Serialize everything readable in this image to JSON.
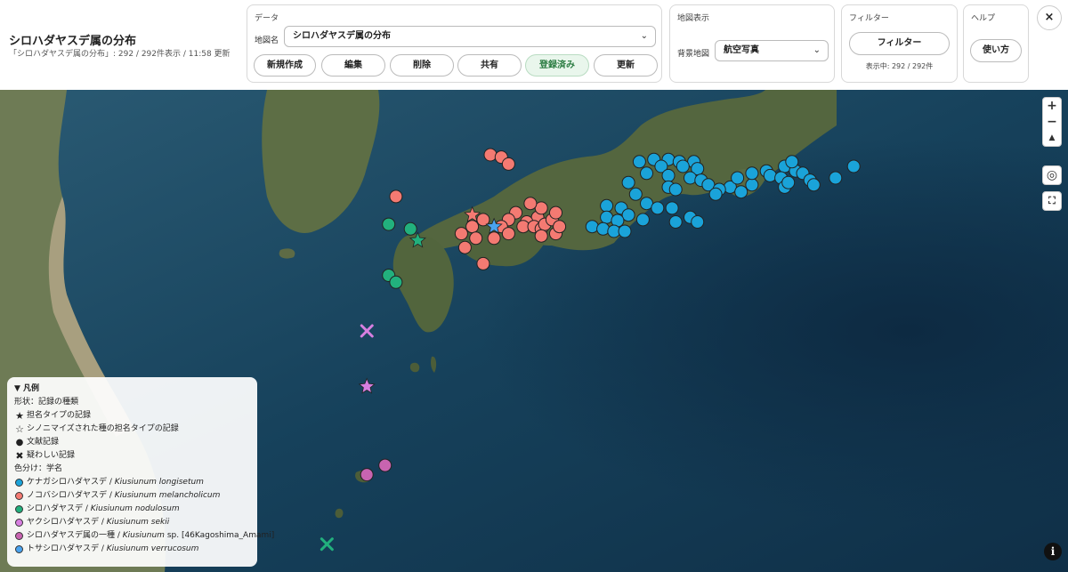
{
  "app": {
    "title": "シロハダヤスデ属の分布",
    "status": "「シロハダヤスデ属の分布」: 292 / 292件表示 / 11:58 更新"
  },
  "data_panel": {
    "label": "データ",
    "map_name_label": "地図名",
    "map_name_value": "シロハダヤスデ属の分布",
    "buttons": [
      "新規作成",
      "編集",
      "削除",
      "共有",
      "登録済み",
      "更新"
    ]
  },
  "map_display": {
    "label": "地図表示",
    "basemap_label": "背景地図",
    "basemap_value": "航空写真"
  },
  "filter_panel": {
    "label": "フィルター",
    "button": "フィルター",
    "status": "表示中: 292 / 292件"
  },
  "help_panel": {
    "label": "ヘルプ",
    "button": "使い方"
  },
  "icons": {
    "close": "×",
    "zoom_in": "+",
    "zoom_out": "−",
    "compass": "▲",
    "locate": "◎",
    "fullscreen": "⛶",
    "info": "i",
    "chevron": "⌄",
    "triangle": "▼"
  },
  "legend": {
    "title": "▼ 凡例",
    "shape_heading": "形状：記録の種類",
    "shapes": [
      {
        "symbol": "★",
        "label": "担名タイプの記録"
      },
      {
        "symbol": "☆",
        "label": "シノニマイズされた種の担名タイプの記録"
      },
      {
        "symbol": "●",
        "label": "文献記録"
      },
      {
        "symbol": "✖",
        "label": "疑わしい記録"
      }
    ],
    "color_heading": "色分け：学名",
    "species": [
      {
        "jp": "ケナガシロハダヤスデ",
        "sci": "Kiusiunum longisetum",
        "suffix": "",
        "color": "#1aa3d9"
      },
      {
        "jp": "ノコバシロハダヤスデ",
        "sci": "Kiusiunum melancholicum",
        "suffix": "",
        "color": "#f47a72"
      },
      {
        "jp": "シロハダヤスデ",
        "sci": "Kiusiunum nodulosum",
        "suffix": "",
        "color": "#22b07d"
      },
      {
        "jp": "ヤクシロハダヤスデ",
        "sci": "Kiusiunum sekii",
        "suffix": "",
        "color": "#d77fe0"
      },
      {
        "jp": "シロハダヤスデ属の一種",
        "sci": "Kiusiunum",
        "suffix": " sp. [46Kagoshima_Amami]",
        "color": "#c864b0"
      },
      {
        "jp": "トサシロハダヤスデ",
        "sci": "Kiusiunum verrucosum",
        "suffix": "",
        "color": "#4aa3ef"
      }
    ]
  },
  "records": {
    "longisetum": [
      [
        136.1,
        35.25
      ],
      [
        136.3,
        35.3
      ],
      [
        136.5,
        35.3
      ],
      [
        136.65,
        35.25
      ],
      [
        136.85,
        35.25
      ],
      [
        136.4,
        35.15
      ],
      [
        136.7,
        35.15
      ],
      [
        136.9,
        35.1
      ],
      [
        136.2,
        35.0
      ],
      [
        136.5,
        34.95
      ],
      [
        136.8,
        34.9
      ],
      [
        136.95,
        34.85
      ],
      [
        135.95,
        34.8
      ],
      [
        136.05,
        34.55
      ],
      [
        136.5,
        34.7
      ],
      [
        136.6,
        34.65
      ],
      [
        137.05,
        34.75
      ],
      [
        137.35,
        34.7
      ],
      [
        137.2,
        34.65
      ],
      [
        137.15,
        34.55
      ],
      [
        137.5,
        34.6
      ],
      [
        137.65,
        34.75
      ],
      [
        137.45,
        34.9
      ],
      [
        137.65,
        35.0
      ],
      [
        137.85,
        35.05
      ],
      [
        137.9,
        34.95
      ],
      [
        138.1,
        35.15
      ],
      [
        138.05,
        34.9
      ],
      [
        138.25,
        35.05
      ],
      [
        138.35,
        35.0
      ],
      [
        138.1,
        34.7
      ],
      [
        138.15,
        34.8
      ],
      [
        138.45,
        34.85
      ],
      [
        138.5,
        34.75
      ],
      [
        138.8,
        34.9
      ],
      [
        139.05,
        35.15
      ],
      [
        138.2,
        35.25
      ],
      [
        135.65,
        34.3
      ],
      [
        135.85,
        34.25
      ],
      [
        135.95,
        34.1
      ],
      [
        135.65,
        34.05
      ],
      [
        135.8,
        33.98
      ],
      [
        135.45,
        33.85
      ],
      [
        135.6,
        33.8
      ],
      [
        135.75,
        33.75
      ],
      [
        135.9,
        33.75
      ],
      [
        136.2,
        34.35
      ],
      [
        136.35,
        34.25
      ],
      [
        136.55,
        34.25
      ],
      [
        136.8,
        34.05
      ],
      [
        136.9,
        33.95
      ],
      [
        136.6,
        33.95
      ],
      [
        136.15,
        34.0
      ]
    ],
    "melancholicum": [
      [
        134.05,
        35.4
      ],
      [
        134.2,
        35.35
      ],
      [
        134.3,
        35.2
      ],
      [
        132.75,
        34.5
      ],
      [
        134.7,
        34.05
      ],
      [
        134.55,
        33.95
      ],
      [
        134.4,
        34.15
      ],
      [
        134.3,
        34.0
      ],
      [
        134.5,
        33.85
      ],
      [
        134.65,
        33.85
      ],
      [
        134.75,
        33.8
      ],
      [
        134.8,
        33.9
      ],
      [
        134.9,
        34.0
      ],
      [
        134.95,
        34.15
      ],
      [
        134.75,
        34.25
      ],
      [
        134.6,
        34.35
      ],
      [
        134.95,
        33.7
      ],
      [
        134.75,
        33.65
      ],
      [
        135.0,
        33.85
      ],
      [
        134.2,
        33.85
      ],
      [
        133.95,
        34.0
      ],
      [
        133.8,
        33.85
      ],
      [
        133.65,
        33.7
      ],
      [
        133.85,
        33.6
      ],
      [
        133.7,
        33.4
      ],
      [
        133.95,
        33.05
      ],
      [
        134.1,
        33.6
      ],
      [
        134.3,
        33.7
      ]
    ],
    "nodulosum": [
      [
        132.65,
        33.9
      ],
      [
        132.95,
        33.8
      ],
      [
        132.65,
        32.8
      ],
      [
        132.75,
        32.65
      ]
    ],
    "sekii": [],
    "amami": [
      [
        132.35,
        28.5
      ],
      [
        132.6,
        28.7
      ]
    ],
    "verrucosum": [],
    "special": [
      {
        "kind": "star",
        "lon": 133.05,
        "lat": 33.55,
        "color": "#22b07d"
      },
      {
        "kind": "star",
        "lon": 134.1,
        "lat": 33.85,
        "color": "#4aa3ef"
      },
      {
        "kind": "star",
        "lon": 132.35,
        "lat": 30.4,
        "color": "#d77fe0"
      },
      {
        "kind": "cross",
        "lon": 132.35,
        "lat": 31.6,
        "color": "#d77fe0"
      },
      {
        "kind": "cross",
        "lon": 131.8,
        "lat": 27.0,
        "color": "#22b07d"
      },
      {
        "kind": "star",
        "lon": 133.8,
        "lat": 34.1,
        "color": "#f47a72"
      }
    ]
  }
}
